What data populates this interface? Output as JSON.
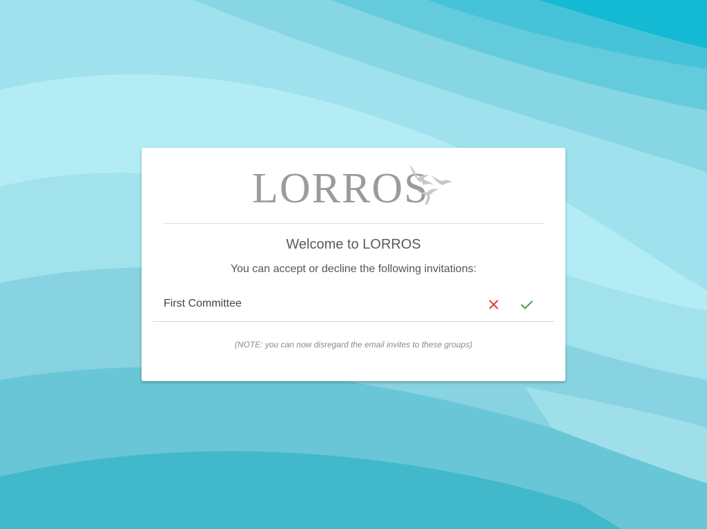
{
  "brand": {
    "logo_text": "LORROS",
    "logo_color": "#9b9b9b"
  },
  "card": {
    "title": "Welcome to LORROS",
    "subtitle": "You can accept or decline the following invitations:",
    "invitations": [
      {
        "name": "First Committee",
        "decline_icon": "close-icon",
        "accept_icon": "check-icon"
      }
    ],
    "note": "(NOTE: you can now disregard the email invites to these groups)"
  },
  "colors": {
    "decline": "#e53935",
    "accept": "#43a047",
    "background_accent": "#00bcd4"
  }
}
